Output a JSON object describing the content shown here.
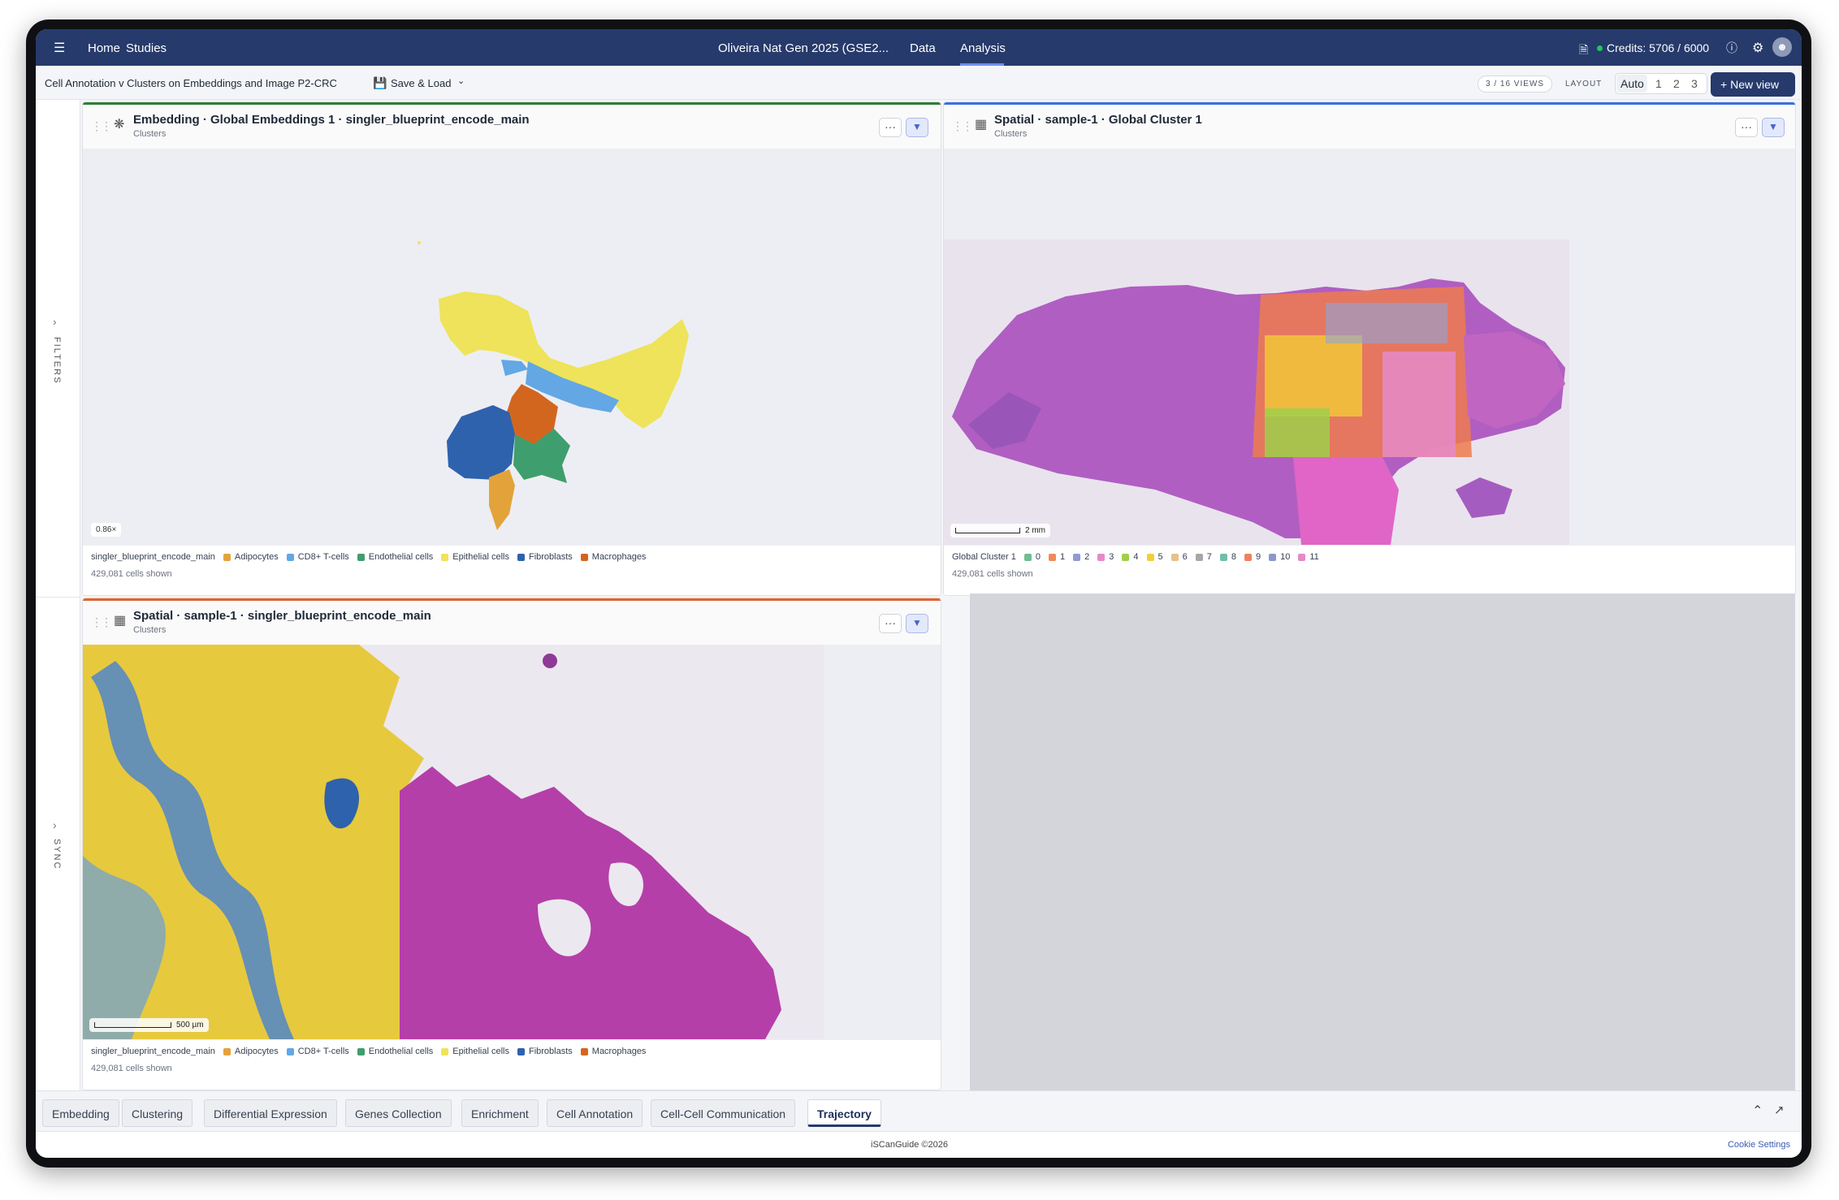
{
  "nav": {
    "home": "Home",
    "studies": "Studies",
    "study_title": "Oliveira Nat Gen 2025 (GSE2...",
    "data": "Data",
    "analysis": "Analysis",
    "credits": "Credits: 5706 / 6000",
    "credits_status_color": "#22c55e"
  },
  "subbar": {
    "view_title": "Cell Annotation v Clusters on Embeddings and Image P2-CRC",
    "save_load": "Save & Load",
    "views_count": "3 / 16 VIEWS",
    "layout_label": "LAYOUT",
    "layout_options": [
      "Auto",
      "1",
      "2",
      "3"
    ],
    "new_view": "New view"
  },
  "rail": {
    "filters": "FILTERS",
    "sync": "SYNC"
  },
  "panels": [
    {
      "title": "Embedding · Global Embeddings 1 · singler_blueprint_encode_main",
      "subtitle": "Clusters",
      "accent": "#2f7d32",
      "zoom": "0.86×",
      "legend_title": "singler_blueprint_encode_main",
      "legend": [
        {
          "label": "Adipocytes",
          "color": "#e3a33a"
        },
        {
          "label": "CD8+ T-cells",
          "color": "#63a7e4"
        },
        {
          "label": "Endothelial cells",
          "color": "#3f9e6e"
        },
        {
          "label": "Epithelial cells",
          "color": "#eee35a"
        },
        {
          "label": "Fibroblasts",
          "color": "#2e62ad"
        },
        {
          "label": "Macrophages",
          "color": "#d3661f"
        }
      ],
      "cells_shown": "429,081 cells shown"
    },
    {
      "title": "Spatial · sample-1 · Global Cluster 1",
      "subtitle": "Clusters",
      "accent": "#3b6fe0",
      "scale": "2 mm",
      "legend_title": "Global Cluster 1",
      "legend": [
        {
          "label": "0",
          "color": "#6fbf8f"
        },
        {
          "label": "1",
          "color": "#f08a5a"
        },
        {
          "label": "2",
          "color": "#8f9ad6"
        },
        {
          "label": "3",
          "color": "#e58ac9"
        },
        {
          "label": "4",
          "color": "#9fcf4a"
        },
        {
          "label": "5",
          "color": "#f2cf3a"
        },
        {
          "label": "6",
          "color": "#e7c08a"
        },
        {
          "label": "7",
          "color": "#a7a7a7"
        },
        {
          "label": "8",
          "color": "#6fbfa9"
        },
        {
          "label": "9",
          "color": "#f08060"
        },
        {
          "label": "10",
          "color": "#8a9ac6"
        },
        {
          "label": "11",
          "color": "#e58ac9"
        }
      ],
      "cells_shown": "429,081 cells shown"
    },
    {
      "title": "Spatial · sample-1 · singler_blueprint_encode_main",
      "subtitle": "Clusters",
      "accent": "#e0642f",
      "scale": "500 µm",
      "legend_title": "singler_blueprint_encode_main",
      "legend": [
        {
          "label": "Adipocytes",
          "color": "#e3a33a"
        },
        {
          "label": "CD8+ T-cells",
          "color": "#63a7e4"
        },
        {
          "label": "Endothelial cells",
          "color": "#3f9e6e"
        },
        {
          "label": "Epithelial cells",
          "color": "#eee35a"
        },
        {
          "label": "Fibroblasts",
          "color": "#2e62ad"
        },
        {
          "label": "Macrophages",
          "color": "#d3661f"
        }
      ],
      "cells_shown": "429,081 cells shown"
    }
  ],
  "tabs": [
    "Embedding",
    "Clustering",
    "Differential Expression",
    "Genes Collection",
    "Enrichment",
    "Cell Annotation",
    "Cell-Cell Communication",
    "Trajectory"
  ],
  "active_tab": "Trajectory",
  "footer": {
    "copyright": "iSCanGuide ©2026",
    "cookie": "Cookie Settings"
  }
}
